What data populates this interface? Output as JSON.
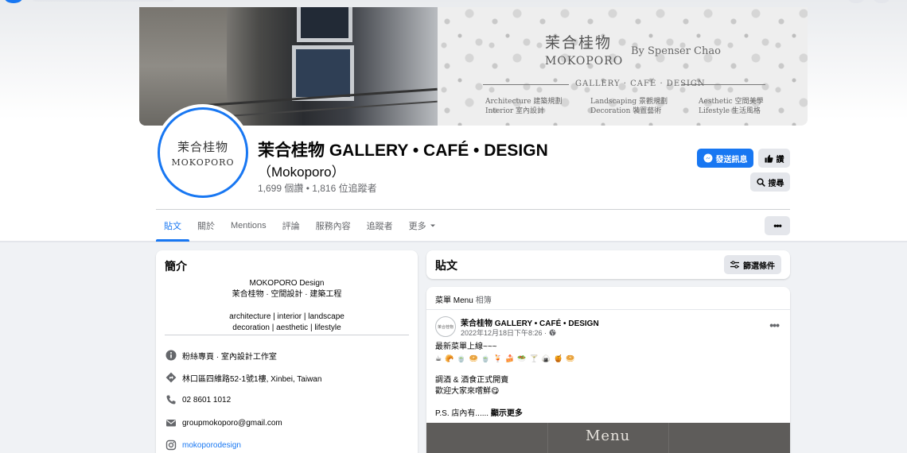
{
  "cover": {
    "title_cn": "茉合桂物",
    "title_en": "MOKOPORO",
    "by": "By  Spenser Chao",
    "subtitle": "GALLERY · CAFÉ · DESIGN",
    "col1": [
      "Architecture 建築規劃",
      "Interior      室內設計"
    ],
    "col2": [
      "Landscaping 景觀規劃",
      "Decoration   裝置藝術"
    ],
    "col3": [
      "Aesthetic 空間美學",
      "Lifestyle  生活風格"
    ]
  },
  "avatar": {
    "line1": "茉合桂物",
    "line2": "MOKOPORO"
  },
  "page": {
    "name": "茉合桂物 GALLERY • CAFÉ • DESIGN",
    "alias": "（Mokoporo）",
    "stats": "1,699 個讚 • 1,816 位追蹤者"
  },
  "actions": {
    "message": "發送訊息",
    "like": "讚",
    "search": "搜尋"
  },
  "tabs": [
    "貼文",
    "關於",
    "Mentions",
    "評論",
    "服務內容",
    "追蹤者",
    "更多"
  ],
  "intro": {
    "title": "簡介",
    "bio": [
      "MOKOPORO Design",
      "茉合桂物 · 空間設計 · 建築工程",
      "",
      "architecture | interior | landscape",
      "decoration | aesthetic | lifestyle"
    ],
    "category": "粉絲專頁 · 室內設計工作室",
    "address": "林口區四維路52-1號1樓, Xinbei, Taiwan",
    "phone": "02 8601 1012",
    "email": "groupmokoporo@gmail.com",
    "instagram": "mokoporodesign"
  },
  "posts": {
    "title": "貼文",
    "filter": "篩選條件"
  },
  "post": {
    "album": "菜單 Menu",
    "album_sub": "相簿",
    "author": "茉合桂物 GALLERY • CAFÉ • DESIGN",
    "time": "2022年12月18日下午8:26 ·",
    "line1": "最新菜單上線~~~",
    "emojis": [
      "☕",
      "🥐",
      "🍵",
      "🥯",
      "🍵",
      "🍹",
      "🍰",
      "🥗",
      "🍸",
      "🍙",
      "🍯",
      "🥯"
    ],
    "line2": "調酒 & 酒食正式開賣",
    "line3": "歡迎大家來嚐鮮😋",
    "line4": "P.S. 店內有......",
    "see_more": "顯示更多",
    "image_caption": "Menu",
    "avatar_text": "茉合桂物"
  }
}
